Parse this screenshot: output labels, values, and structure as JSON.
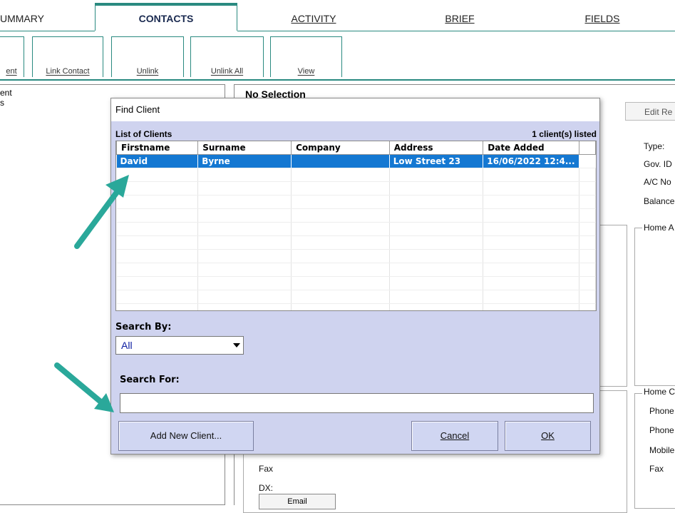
{
  "tabs": [
    {
      "label": "UMMARY"
    },
    {
      "label": "CONTACTS"
    },
    {
      "label": "ACTIVITY"
    },
    {
      "label": "BRIEF"
    },
    {
      "label": "FIELDS"
    }
  ],
  "toolbar": {
    "buttons": [
      "ent",
      "Link Contact",
      "Unlink",
      "Unlink All",
      "View"
    ]
  },
  "left_panel": {
    "line1": "ent",
    "line2": "s"
  },
  "right_panel": {
    "heading": "No Selection",
    "edit_button": "Edit Re",
    "fields": [
      "Type:",
      "Gov. ID",
      "A/C No",
      "Balance"
    ],
    "home_address_label": "Home A",
    "home_contact_label": "Home C",
    "phones": [
      "Phone",
      "Phone",
      "Mobile",
      "Fax"
    ],
    "fax_label": "Fax",
    "dx_label": "DX:",
    "email_button_fragment": "Email"
  },
  "dialog": {
    "title": "Find Client",
    "list_label": "List of Clients",
    "count": "1 client(s) listed",
    "columns": [
      "Firstname",
      "Surname",
      "Company",
      "Address",
      "Date Added"
    ],
    "rows": [
      {
        "firstname": "David",
        "surname": "Byrne",
        "company": "",
        "address": "Low Street 23",
        "date_added": "16/06/2022 12:4..."
      }
    ],
    "search_by_label": "Search By:",
    "search_by_value": "All",
    "search_for_label": "Search For:",
    "search_for_value": "",
    "add_button": "Add New Client...",
    "cancel_button": "Cancel",
    "ok_button": "OK"
  },
  "colors": {
    "accent": "#2a8a80",
    "dialog_bg": "#cfd3ef",
    "selection": "#1478d2",
    "annotation_arrow": "#2aa89a"
  }
}
